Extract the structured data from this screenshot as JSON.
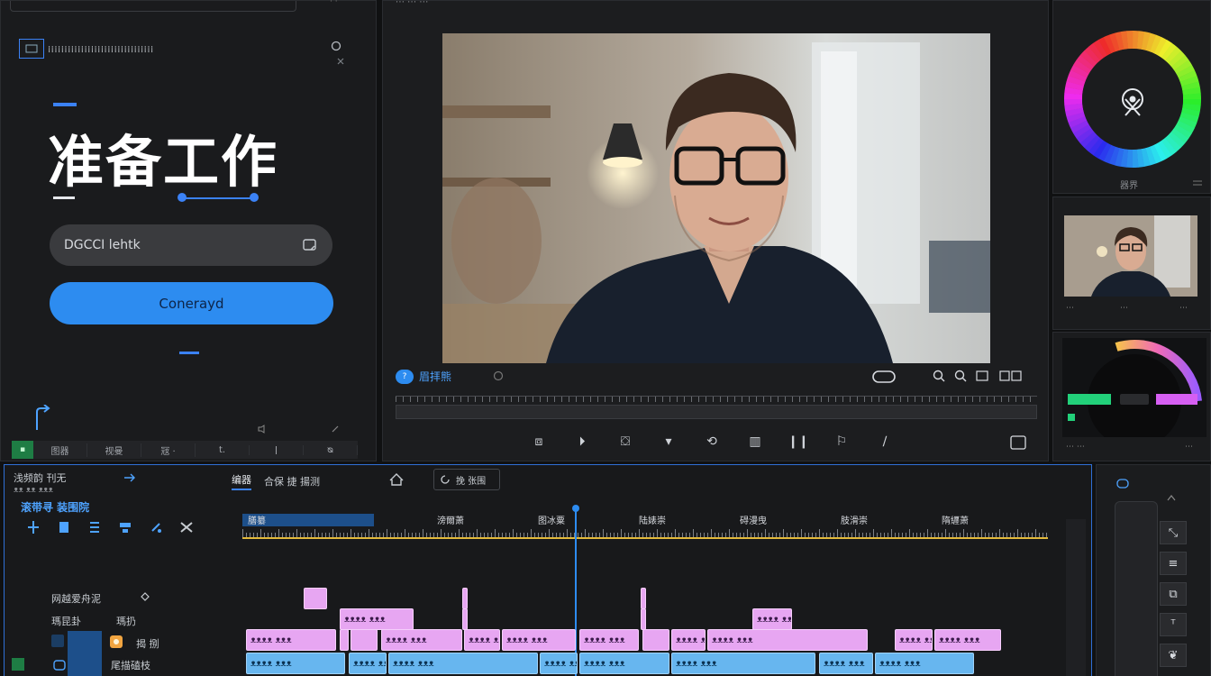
{
  "left": {
    "waveform_text": "⁞⁞⁞⁞⁞⁞⁞⁞⁞⁞⁞⁞⁞⁞⁞⁞⁞⁞⁞⁞⁞⁞⁞⁞⁞⁞⁞⁞⁞⁞⁞⁞",
    "title": "准备工作",
    "input_value": "DGCCI lehtk",
    "primary_button": "Conerayd",
    "toolbar": [
      "▪",
      "图器",
      "视曼",
      "㓂 ·",
      "t.",
      "ǀ",
      "ᴓ"
    ]
  },
  "preview": {
    "time_label": "眉拝熊",
    "time_badge": "?",
    "transport": [
      "⧈",
      "⏵",
      "⛋",
      "▾",
      "⟲",
      "▥",
      "❙❙",
      "⚐",
      "∕"
    ]
  },
  "right": {
    "wheel_label": "器界"
  },
  "timeline": {
    "title": "浅频韵 刊无",
    "subtitle": "ᴥᴥ ᴥᴥ ᴥᴥᴥ",
    "blue_label": "滚带寻 装围院",
    "tabs": [
      "编器",
      "合保 捷 揚测"
    ],
    "search_label": "挽 张围",
    "ruler_labels": [
      "膳纂",
      "滂爾萧",
      "图冰粟",
      "陆婊崇",
      "碍漫曳",
      "肢滑崇",
      "隋纒萧"
    ],
    "tracks": [
      {
        "name": "网越爱舟泥"
      },
      {
        "name": "瑪昆卦"
      },
      {
        "name": "瑪扔"
      },
      {
        "name": "揭 捌"
      },
      {
        "name": "尾描磕枝"
      }
    ],
    "clip_label": "ᴥᴥᴥᴥ ᴥᴥᴥ"
  },
  "colors": {
    "accent": "#2d8cf0",
    "clip_pink": "#e7a6f2",
    "clip_blue": "#67b6ef",
    "ruler_yellow": "#e2b93b"
  }
}
